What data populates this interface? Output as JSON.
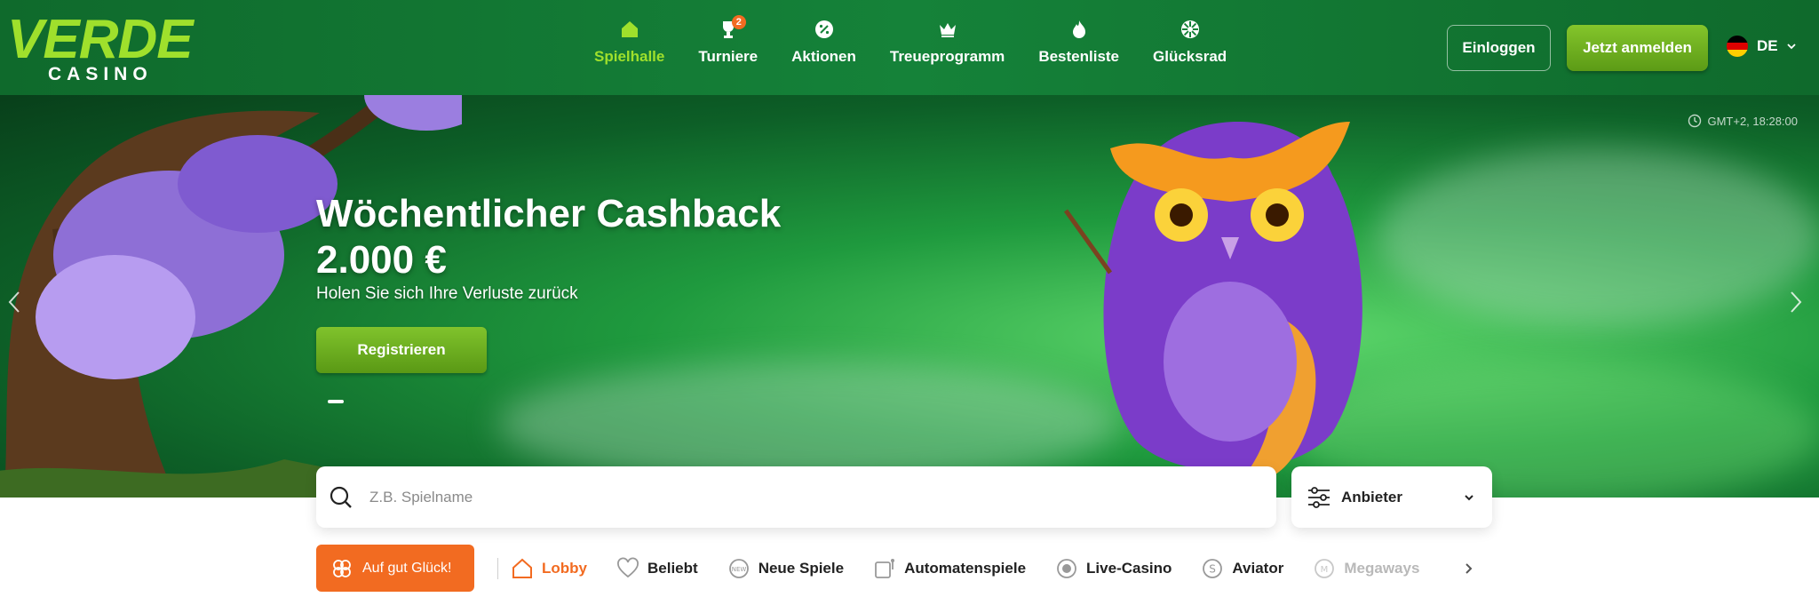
{
  "brand": {
    "name_top": "VERDE",
    "name_bottom": "CASINO"
  },
  "nav": {
    "items": [
      {
        "label": "Spielhalle",
        "icon": "house-icon",
        "active": true
      },
      {
        "label": "Turniere",
        "icon": "trophy-icon",
        "badge": "2"
      },
      {
        "label": "Aktionen",
        "icon": "percent-badge-icon"
      },
      {
        "label": "Treueprogramm",
        "icon": "crown-icon"
      },
      {
        "label": "Bestenliste",
        "icon": "flame-icon"
      },
      {
        "label": "Glücksrad",
        "icon": "wheel-icon"
      }
    ]
  },
  "header_actions": {
    "login_label": "Einloggen",
    "signup_label": "Jetzt anmelden",
    "language": "DE"
  },
  "hero": {
    "time": "GMT+2, 18:28:00",
    "title": "Wöchentlicher Cashback",
    "amount": "2.000 €",
    "subtitle": "Holen Sie sich Ihre Verluste zurück",
    "cta_label": "Registrieren"
  },
  "search": {
    "placeholder": "Z.B. Spielname",
    "provider_label": "Anbieter"
  },
  "categories": {
    "lucky_label": "Auf gut Glück!",
    "items": [
      {
        "label": "Lobby",
        "icon": "house-outline-icon",
        "active": true
      },
      {
        "label": "Beliebt",
        "icon": "heart-icon"
      },
      {
        "label": "Neue Spiele",
        "icon": "new-badge-icon"
      },
      {
        "label": "Automatenspiele",
        "icon": "slot-machine-icon"
      },
      {
        "label": "Live-Casino",
        "icon": "live-icon"
      },
      {
        "label": "Aviator",
        "icon": "aviator-icon"
      },
      {
        "label": "Megaways",
        "icon": "megaways-icon"
      }
    ]
  },
  "colors": {
    "header_green": "#158239",
    "accent_lime": "#9fe02c",
    "accent_orange": "#f26b21",
    "cta_green": "#6faf1f"
  }
}
